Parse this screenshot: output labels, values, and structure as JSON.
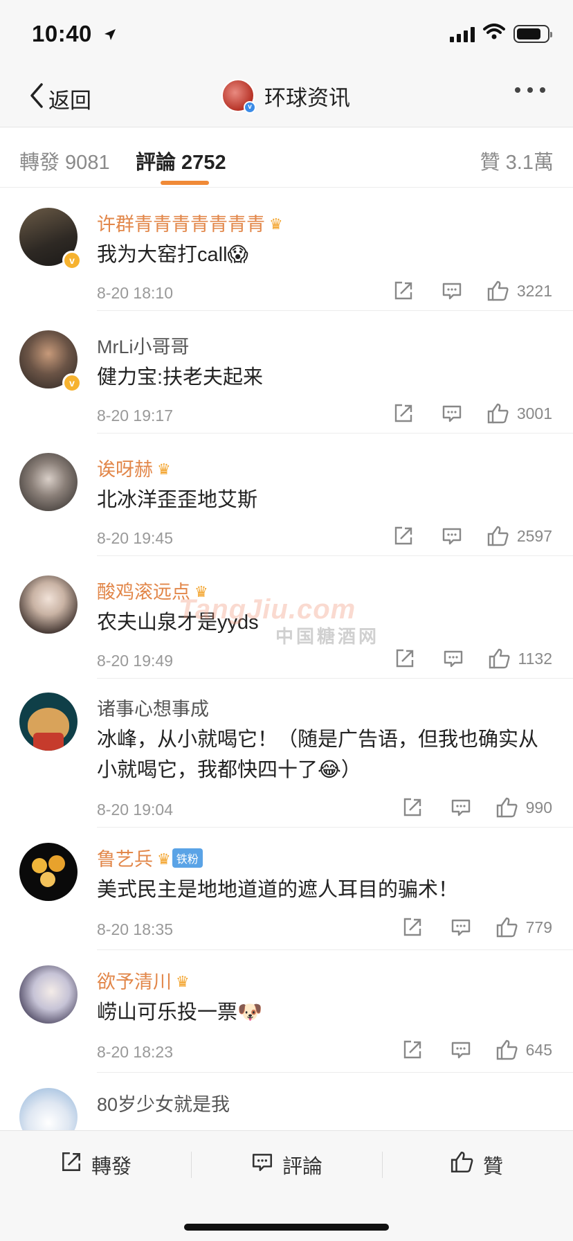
{
  "status_bar": {
    "time": "10:40"
  },
  "nav": {
    "back_label": "返回",
    "title": "环球资讯"
  },
  "tabs": [
    {
      "label": "轉發 9081"
    },
    {
      "label": "評論 2752"
    },
    {
      "label": "贊 3.1萬"
    }
  ],
  "comments": [
    {
      "name": "许群青青青青青青青",
      "text": "我为大窑打call😱",
      "time": "8-20 18:10",
      "likes": "3221",
      "vip": true,
      "verified": true
    },
    {
      "name": "MrLi小哥哥",
      "text": "健力宝:扶老夫起来",
      "time": "8-20 19:17",
      "likes": "3001",
      "vip": false,
      "verified": true
    },
    {
      "name": "诶呀赫",
      "text": "北冰洋歪歪地艾斯",
      "time": "8-20 19:45",
      "likes": "2597",
      "vip": true,
      "verified": false
    },
    {
      "name": "酸鸡滚远点",
      "text": "农夫山泉才是yyds",
      "time": "8-20 19:49",
      "likes": "1132",
      "vip": true,
      "verified": false
    },
    {
      "name": "诸事心想事成",
      "text": "冰峰，从小就喝它！（随是广告语，但我也确实从小就喝它，我都快四十了😂）",
      "time": "8-20 19:04",
      "likes": "990",
      "vip": false,
      "verified": false
    },
    {
      "name": "鲁艺兵",
      "text": "美式民主是地地道道的遮人耳目的骗术！",
      "time": "8-20 18:35",
      "likes": "779",
      "vip": true,
      "verified": false,
      "fan_tag": "铁粉"
    },
    {
      "name": "欲予清川",
      "text": "崂山可乐投一票🐶",
      "time": "8-20 18:23",
      "likes": "645",
      "vip": true,
      "verified": false
    },
    {
      "name": "80岁少女就是我",
      "text": "",
      "time": "",
      "likes": "",
      "vip": false,
      "verified": false
    }
  ],
  "watermark": {
    "en": "TangJiu.com",
    "cn": "中国糖酒网"
  },
  "bottom_bar": {
    "repost_label": "轉發",
    "comment_label": "評論",
    "like_label": "贊"
  },
  "colors": {
    "accent": "#f08a37",
    "vip_name": "#e2874a",
    "meta": "#999999"
  }
}
